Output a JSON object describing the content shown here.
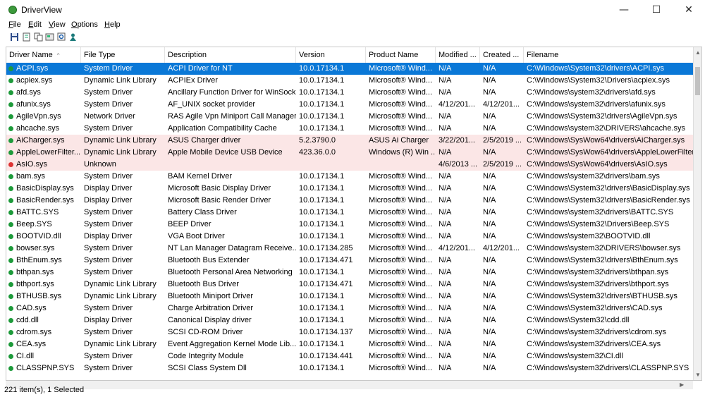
{
  "window": {
    "title": "DriverView",
    "minimize": "—",
    "maximize": "☐",
    "close": "✕"
  },
  "menu": [
    {
      "first": "F",
      "rest": "ile"
    },
    {
      "first": "E",
      "rest": "dit"
    },
    {
      "first": "V",
      "rest": "iew"
    },
    {
      "first": "O",
      "rest": "ptions"
    },
    {
      "first": "H",
      "rest": "elp"
    }
  ],
  "toolbar": {
    "icons": [
      "save-icon",
      "html-report-icon",
      "copy-icon",
      "properties-icon",
      "find-icon",
      "about-icon"
    ]
  },
  "columns": [
    "Driver Name",
    "File Type",
    "Description",
    "Version",
    "Product Name",
    "Modified ...",
    "Created ...",
    "Filename"
  ],
  "rows": [
    {
      "name": "ACPI.sys",
      "type": "System Driver",
      "desc": "ACPI Driver for NT",
      "ver": "10.0.17134.1",
      "product": "Microsoft® Wind...",
      "mod": "N/A",
      "cre": "N/A",
      "file": "C:\\Windows\\System32\\drivers\\ACPI.sys",
      "state": "selected",
      "dot": "green"
    },
    {
      "name": "acpiex.sys",
      "type": "Dynamic Link Library",
      "desc": "ACPIEx Driver",
      "ver": "10.0.17134.1",
      "product": "Microsoft® Wind...",
      "mod": "N/A",
      "cre": "N/A",
      "file": "C:\\Windows\\System32\\Drivers\\acpiex.sys",
      "state": "",
      "dot": "green"
    },
    {
      "name": "afd.sys",
      "type": "System Driver",
      "desc": "Ancillary Function Driver for WinSock",
      "ver": "10.0.17134.1",
      "product": "Microsoft® Wind...",
      "mod": "N/A",
      "cre": "N/A",
      "file": "C:\\Windows\\system32\\drivers\\afd.sys",
      "state": "",
      "dot": "green"
    },
    {
      "name": "afunix.sys",
      "type": "System Driver",
      "desc": "AF_UNIX socket provider",
      "ver": "10.0.17134.1",
      "product": "Microsoft® Wind...",
      "mod": "4/12/201...",
      "cre": "4/12/201...",
      "file": "C:\\Windows\\system32\\drivers\\afunix.sys",
      "state": "",
      "dot": "green"
    },
    {
      "name": "AgileVpn.sys",
      "type": "Network Driver",
      "desc": "RAS Agile Vpn Miniport Call Manager",
      "ver": "10.0.17134.1",
      "product": "Microsoft® Wind...",
      "mod": "N/A",
      "cre": "N/A",
      "file": "C:\\Windows\\System32\\drivers\\AgileVpn.sys",
      "state": "",
      "dot": "green"
    },
    {
      "name": "ahcache.sys",
      "type": "System Driver",
      "desc": "Application Compatibility Cache",
      "ver": "10.0.17134.1",
      "product": "Microsoft® Wind...",
      "mod": "N/A",
      "cre": "N/A",
      "file": "C:\\Windows\\system32\\DRIVERS\\ahcache.sys",
      "state": "",
      "dot": "green"
    },
    {
      "name": "AiCharger.sys",
      "type": "Dynamic Link Library",
      "desc": "ASUS Charger driver",
      "ver": "5.2.3790.0",
      "product": "ASUS Ai Charger",
      "mod": "3/22/201...",
      "cre": "2/5/2019 ...",
      "file": "C:\\Windows\\SysWow64\\drivers\\AiCharger.sys",
      "state": "pink",
      "dot": "green"
    },
    {
      "name": "AppleLowerFilter....",
      "type": "Dynamic Link Library",
      "desc": "Apple Mobile Device USB Device",
      "ver": "423.36.0.0",
      "product": "Windows (R) Win ...",
      "mod": "N/A",
      "cre": "N/A",
      "file": "C:\\Windows\\SysWow64\\drivers\\AppleLowerFilter.sys",
      "state": "pink",
      "dot": "green"
    },
    {
      "name": "AsIO.sys",
      "type": "Unknown",
      "desc": "",
      "ver": "",
      "product": "",
      "mod": "4/6/2013 ...",
      "cre": "2/5/2019 ...",
      "file": "C:\\Windows\\SysWow64\\drivers\\AsIO.sys",
      "state": "pink",
      "dot": "red"
    },
    {
      "name": "bam.sys",
      "type": "System Driver",
      "desc": "BAM Kernel Driver",
      "ver": "10.0.17134.1",
      "product": "Microsoft® Wind...",
      "mod": "N/A",
      "cre": "N/A",
      "file": "C:\\Windows\\system32\\drivers\\bam.sys",
      "state": "",
      "dot": "green"
    },
    {
      "name": "BasicDisplay.sys",
      "type": "Display Driver",
      "desc": "Microsoft Basic Display Driver",
      "ver": "10.0.17134.1",
      "product": "Microsoft® Wind...",
      "mod": "N/A",
      "cre": "N/A",
      "file": "C:\\Windows\\System32\\drivers\\BasicDisplay.sys",
      "state": "",
      "dot": "green"
    },
    {
      "name": "BasicRender.sys",
      "type": "Display Driver",
      "desc": "Microsoft Basic Render Driver",
      "ver": "10.0.17134.1",
      "product": "Microsoft® Wind...",
      "mod": "N/A",
      "cre": "N/A",
      "file": "C:\\Windows\\System32\\drivers\\BasicRender.sys",
      "state": "",
      "dot": "green"
    },
    {
      "name": "BATTC.SYS",
      "type": "System Driver",
      "desc": "Battery Class Driver",
      "ver": "10.0.17134.1",
      "product": "Microsoft® Wind...",
      "mod": "N/A",
      "cre": "N/A",
      "file": "C:\\Windows\\system32\\drivers\\BATTC.SYS",
      "state": "",
      "dot": "green"
    },
    {
      "name": "Beep.SYS",
      "type": "System Driver",
      "desc": "BEEP Driver",
      "ver": "10.0.17134.1",
      "product": "Microsoft® Wind...",
      "mod": "N/A",
      "cre": "N/A",
      "file": "C:\\Windows\\System32\\Drivers\\Beep.SYS",
      "state": "",
      "dot": "green"
    },
    {
      "name": "BOOTVID.dll",
      "type": "Display Driver",
      "desc": "VGA Boot Driver",
      "ver": "10.0.17134.1",
      "product": "Microsoft® Wind...",
      "mod": "N/A",
      "cre": "N/A",
      "file": "C:\\Windows\\system32\\BOOTVID.dll",
      "state": "",
      "dot": "green"
    },
    {
      "name": "bowser.sys",
      "type": "System Driver",
      "desc": "NT Lan Manager Datagram Receive...",
      "ver": "10.0.17134.285",
      "product": "Microsoft® Wind...",
      "mod": "4/12/201...",
      "cre": "4/12/201...",
      "file": "C:\\Windows\\system32\\DRIVERS\\bowser.sys",
      "state": "",
      "dot": "green"
    },
    {
      "name": "BthEnum.sys",
      "type": "System Driver",
      "desc": "Bluetooth Bus Extender",
      "ver": "10.0.17134.471",
      "product": "Microsoft® Wind...",
      "mod": "N/A",
      "cre": "N/A",
      "file": "C:\\Windows\\System32\\drivers\\BthEnum.sys",
      "state": "",
      "dot": "green"
    },
    {
      "name": "bthpan.sys",
      "type": "System Driver",
      "desc": "Bluetooth Personal Area Networking",
      "ver": "10.0.17134.1",
      "product": "Microsoft® Wind...",
      "mod": "N/A",
      "cre": "N/A",
      "file": "C:\\Windows\\system32\\drivers\\bthpan.sys",
      "state": "",
      "dot": "green"
    },
    {
      "name": "bthport.sys",
      "type": "Dynamic Link Library",
      "desc": "Bluetooth Bus Driver",
      "ver": "10.0.17134.471",
      "product": "Microsoft® Wind...",
      "mod": "N/A",
      "cre": "N/A",
      "file": "C:\\Windows\\system32\\drivers\\bthport.sys",
      "state": "",
      "dot": "green"
    },
    {
      "name": "BTHUSB.sys",
      "type": "Dynamic Link Library",
      "desc": "Bluetooth Miniport Driver",
      "ver": "10.0.17134.1",
      "product": "Microsoft® Wind...",
      "mod": "N/A",
      "cre": "N/A",
      "file": "C:\\Windows\\System32\\drivers\\BTHUSB.sys",
      "state": "",
      "dot": "green"
    },
    {
      "name": "CAD.sys",
      "type": "System Driver",
      "desc": "Charge Arbitration Driver",
      "ver": "10.0.17134.1",
      "product": "Microsoft® Wind...",
      "mod": "N/A",
      "cre": "N/A",
      "file": "C:\\Windows\\System32\\drivers\\CAD.sys",
      "state": "",
      "dot": "green"
    },
    {
      "name": "cdd.dll",
      "type": "Display Driver",
      "desc": "Canonical Display driver",
      "ver": "10.0.17134.1",
      "product": "Microsoft® Wind...",
      "mod": "N/A",
      "cre": "N/A",
      "file": "C:\\Windows\\System32\\cdd.dll",
      "state": "",
      "dot": "green"
    },
    {
      "name": "cdrom.sys",
      "type": "System Driver",
      "desc": "SCSI CD-ROM Driver",
      "ver": "10.0.17134.137",
      "product": "Microsoft® Wind...",
      "mod": "N/A",
      "cre": "N/A",
      "file": "C:\\Windows\\system32\\drivers\\cdrom.sys",
      "state": "",
      "dot": "green"
    },
    {
      "name": "CEA.sys",
      "type": "Dynamic Link Library",
      "desc": "Event Aggregation Kernel Mode Lib...",
      "ver": "10.0.17134.1",
      "product": "Microsoft® Wind...",
      "mod": "N/A",
      "cre": "N/A",
      "file": "C:\\Windows\\system32\\drivers\\CEA.sys",
      "state": "",
      "dot": "green"
    },
    {
      "name": "CI.dll",
      "type": "System Driver",
      "desc": "Code Integrity Module",
      "ver": "10.0.17134.441",
      "product": "Microsoft® Wind...",
      "mod": "N/A",
      "cre": "N/A",
      "file": "C:\\Windows\\system32\\CI.dll",
      "state": "",
      "dot": "green"
    },
    {
      "name": "CLASSPNP.SYS",
      "type": "System Driver",
      "desc": "SCSI Class System Dll",
      "ver": "10.0.17134.1",
      "product": "Microsoft® Wind...",
      "mod": "N/A",
      "cre": "N/A",
      "file": "C:\\Windows\\system32\\drivers\\CLASSPNP.SYS",
      "state": "",
      "dot": "green"
    }
  ],
  "status": {
    "text": "221 item(s), 1 Selected"
  },
  "colors": {
    "selection": "#0a78d7",
    "highlight_row": "#fbe6e6",
    "ok_dot": "#1d9a3a",
    "error_dot": "#d33333"
  }
}
